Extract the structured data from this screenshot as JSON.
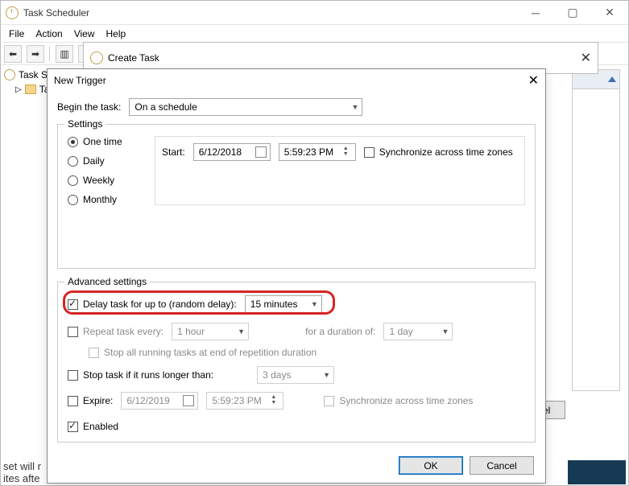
{
  "app": {
    "title": "Task Scheduler",
    "menus": {
      "file": "File",
      "action": "Action",
      "view": "View",
      "help": "Help"
    },
    "tree": {
      "root": "Task S",
      "child": "Ta"
    },
    "cancel_floating": "ancel"
  },
  "create_task": {
    "title": "Create Task"
  },
  "dialog": {
    "title": "New Trigger",
    "begin_label": "Begin the task:",
    "begin_value": "On a schedule",
    "settings_group": "Settings",
    "schedule": {
      "one_time": "One time",
      "daily": "Daily",
      "weekly": "Weekly",
      "monthly": "Monthly",
      "start_label": "Start:",
      "start_date": "6/12/2018",
      "start_time": "5:59:23 PM",
      "sync_tz": "Synchronize across time zones"
    },
    "advanced_group": "Advanced settings",
    "advanced": {
      "delay_label": "Delay task for up to (random delay):",
      "delay_value": "15 minutes",
      "repeat_label": "Repeat task every:",
      "repeat_value": "1 hour",
      "repeat_duration_label": "for a duration of:",
      "repeat_duration_value": "1 day",
      "stop_all_label": "Stop all running tasks at end of repetition duration",
      "stop_long_label": "Stop task if it runs longer than:",
      "stop_long_value": "3 days",
      "expire_label": "Expire:",
      "expire_date": "6/12/2019",
      "expire_time": "5:59:23 PM",
      "sync_tz2": "Synchronize across time zones",
      "enabled_label": "Enabled"
    },
    "ok": "OK",
    "cancel": "Cancel"
  },
  "bottom": {
    "line1": "set will r",
    "line2": "ites afte"
  }
}
